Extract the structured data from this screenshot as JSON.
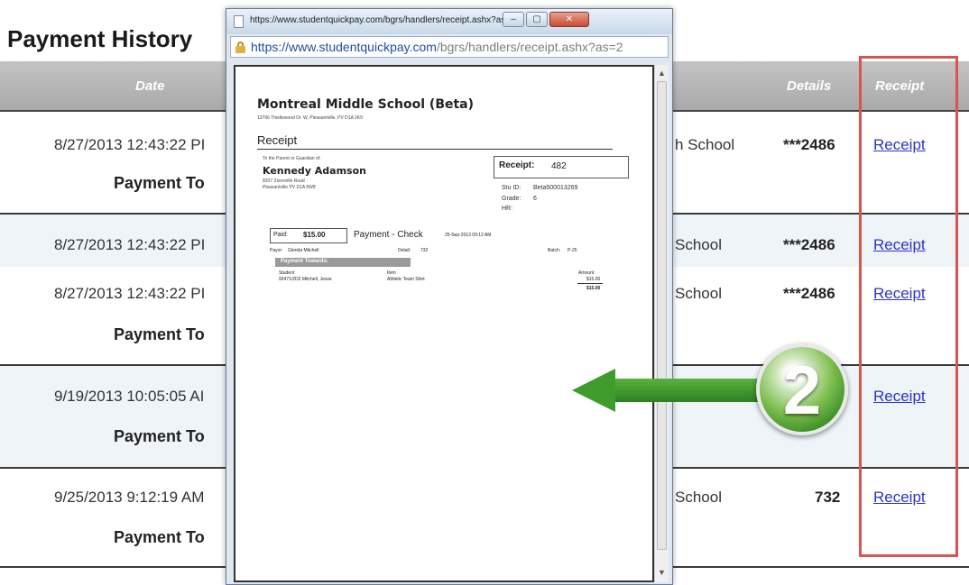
{
  "page": {
    "title": "Payment History",
    "columns": {
      "date": "Date",
      "details": "Details",
      "receipt": "Receipt"
    }
  },
  "rows": [
    {
      "date": "8/27/2013 12:43:22 PI",
      "school": "h School",
      "details": "***2486",
      "link": "Receipt"
    },
    {
      "date": "8/27/2013 12:43:22 PI",
      "school": "School",
      "details": "***2486",
      "link": "Receipt"
    },
    {
      "date": "8/27/2013 12:43:22 PI",
      "school": "School",
      "details": "***2486",
      "link": "Receipt"
    },
    {
      "date": "9/19/2013 10:05:05 AI",
      "school": "",
      "details": "",
      "link": "Receipt"
    },
    {
      "date": "9/25/2013 9:12:19 AM",
      "school": "School",
      "details": "732",
      "link": "Receipt"
    }
  ],
  "totals_label": "Payment To",
  "popup": {
    "window_title": "https://www.studentquickpay.com/bgrs/handlers/receipt.ashx?as=20...",
    "url_host": "https://www.studentquickpay.com",
    "url_path": "/bgrs/handlers/receipt.ashx?as=2",
    "buttons": {
      "minimize": "–",
      "maximize": "▢",
      "close": "✕"
    },
    "scroll_up": "▲",
    "scroll_down": "▼"
  },
  "receipt": {
    "school": "Montreal Middle School (Beta)",
    "address": "13766 Thistlewood Dr. W, Pleasantville, PV D1A 2K9",
    "heading": "Receipt",
    "to_line": "To the Parent or Guardian of:",
    "student_name": "Kennedy Adamson",
    "street": "8207 Zionsville Road",
    "city": "Pleasantville PV D1A 6W8",
    "receipt_label": "Receipt:",
    "receipt_no": "482",
    "stu_id_label": "Stu ID:",
    "stu_id": "Beta500013269",
    "grade_label": "Grade:",
    "grade": "6",
    "hr_label": "HR:",
    "paid_label": "Paid:",
    "paid_amount": "$15.00",
    "payment_type": "Payment - Check",
    "payment_date": "25-Sep-2013 09:12 AM",
    "payor_label": "Payor:",
    "payor": "Glenda Mitchell",
    "detail_label": "Detail:",
    "detail": "732",
    "batch_label": "Batch:",
    "batch": "P-25",
    "payment_towards": "Payment Towards:",
    "col_student": "Student",
    "col_item": "Item",
    "col_amount": "Amount",
    "line_student": "92471/2D2 Mitchell, Jesse",
    "line_item": "Athletic Team Shirt",
    "line_amount": "$15.00",
    "line_total": "$15.00"
  },
  "annotation": {
    "step_number": "2",
    "colors": {
      "arrow": "#3f9b2b",
      "highlight": "#d9534f"
    }
  }
}
